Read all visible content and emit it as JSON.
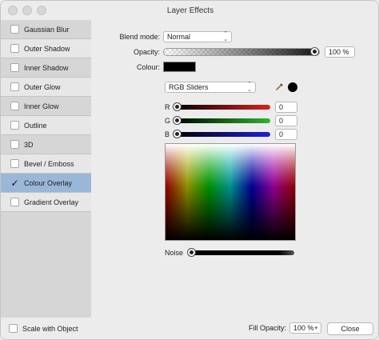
{
  "window": {
    "title": "Layer Effects"
  },
  "sidebar": {
    "items": [
      {
        "label": "Gaussian Blur",
        "checked": false
      },
      {
        "label": "Outer Shadow",
        "checked": false
      },
      {
        "label": "Inner Shadow",
        "checked": false
      },
      {
        "label": "Outer Glow",
        "checked": false
      },
      {
        "label": "Inner Glow",
        "checked": false
      },
      {
        "label": "Outline",
        "checked": false
      },
      {
        "label": "3D",
        "checked": false
      },
      {
        "label": "Bevel / Emboss",
        "checked": false
      },
      {
        "label": "Colour Overlay",
        "checked": true
      },
      {
        "label": "Gradient Overlay",
        "checked": false
      }
    ],
    "checkmark": "✓"
  },
  "main": {
    "blend_mode_label": "Blend mode:",
    "blend_mode_value": "Normal",
    "opacity_label": "Opacity:",
    "opacity_value": "100 %",
    "opacity_level": 1.0,
    "colour_label": "Colour:",
    "colour_value": "#000000",
    "mode_select_value": "RGB Sliders",
    "sliders": [
      {
        "label": "R",
        "value": "0",
        "gradient": "linear-gradient(to right, #000000, #d62420)"
      },
      {
        "label": "G",
        "value": "0",
        "gradient": "linear-gradient(to right, #000000, #2bb52b)"
      },
      {
        "label": "B",
        "value": "0",
        "gradient": "linear-gradient(to right, #000000, #2020d8)"
      }
    ],
    "noise_label": "Noise",
    "noise_level": 0
  },
  "footer": {
    "scale_label": "Scale with Object",
    "fill_opacity_label": "Fill Opacity:",
    "fill_opacity_value": "100 %",
    "close_label": "Close"
  },
  "icons": {
    "dropdown": "⌃⌄",
    "select_chevron": "▾",
    "eyedropper": "eyedropper-icon"
  },
  "colors": {
    "active_item": "#9ab7d8",
    "sidebar_bg": "#d6d6d6"
  }
}
